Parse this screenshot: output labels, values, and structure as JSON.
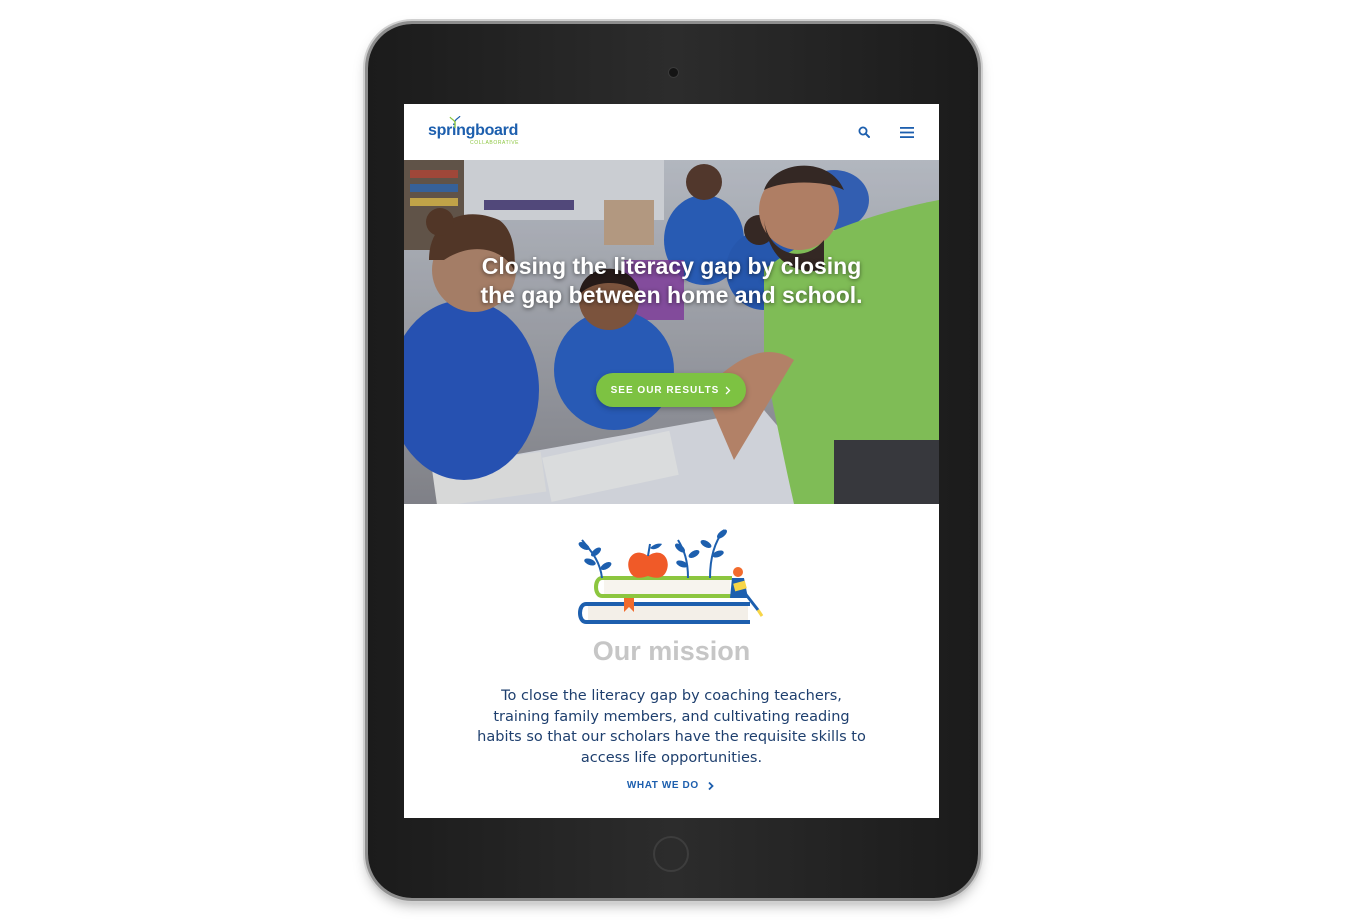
{
  "header": {
    "logo_text": "springboard",
    "logo_sub": "COLLABORATIVE",
    "search_icon": "search-icon",
    "menu_icon": "hamburger-menu-icon"
  },
  "hero": {
    "title": "Closing the literacy gap by closing the gap between home and school.",
    "cta_label": "SEE OUR RESULTS",
    "cta_icon": "chevron-right-icon"
  },
  "mission": {
    "illustration": "books-apple-plants-illustration",
    "heading": "Our mission",
    "text": "To close the literacy gap by coaching teachers, training family members, and cultivating reading habits so that our scholars have the requisite skills to access life opportunities.",
    "link_label": "WHAT WE DO",
    "link_icon": "chevron-right-icon"
  },
  "colors": {
    "brand_blue": "#1d5fae",
    "brand_green": "#7dc242",
    "heading_gray": "#c6c6c6",
    "body_navy": "#1e3f6e"
  }
}
